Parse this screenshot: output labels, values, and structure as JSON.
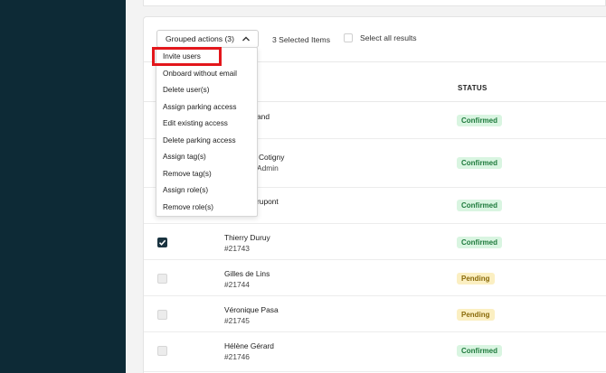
{
  "toolbar": {
    "grouped_actions_label": "Grouped actions (3)",
    "selected_count": "3 Selected Items",
    "select_all_label": "Select all results"
  },
  "table": {
    "status_header": "STATUS"
  },
  "dropdown": {
    "items": [
      "Invite users",
      "Onboard without email",
      "Delete user(s)",
      "Assign parking access",
      "Edit existing access",
      "Delete parking access",
      "Assign tag(s)",
      "Remove tag(s)",
      "Assign role(s)",
      "Remove role(s)"
    ]
  },
  "rows": [
    {
      "name": "and",
      "sub": "",
      "status": "Confirmed",
      "checked": false
    },
    {
      "name": "Cotigny",
      "sub": "Admin",
      "status": "Confirmed",
      "checked": false
    },
    {
      "name": "rupont",
      "sub": "",
      "status": "Confirmed",
      "checked": false
    },
    {
      "name": "Thierry Duruy",
      "sub": "#21743",
      "status": "Confirmed",
      "checked": true
    },
    {
      "name": "Gilles de Lins",
      "sub": "#21744",
      "status": "Pending",
      "checked": false
    },
    {
      "name": "Véronique Pasa",
      "sub": "#21745",
      "status": "Pending",
      "checked": false
    },
    {
      "name": "Hélène Gérard",
      "sub": "#21746",
      "status": "Confirmed",
      "checked": false
    }
  ],
  "colors": {
    "sidebar": "#0d2a36",
    "highlight": "#e3161b",
    "confirmed_bg": "#d9f5e1",
    "pending_bg": "#fbefc2"
  }
}
